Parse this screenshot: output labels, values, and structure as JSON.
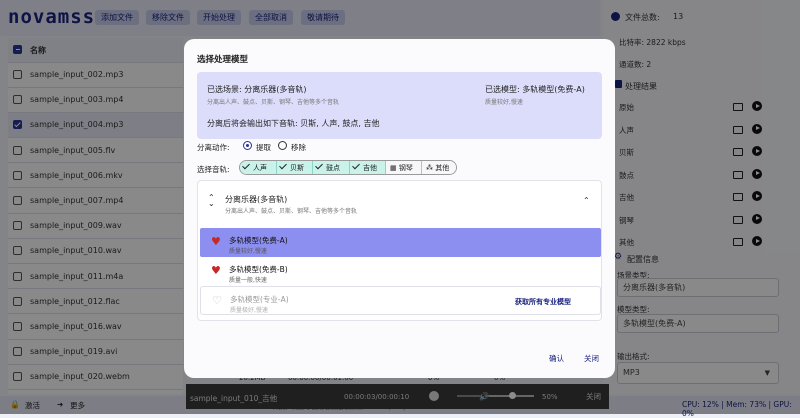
{
  "app": {
    "logo": "novamss",
    "toolbar": [
      "添加文件",
      "移除文件",
      "开始处理",
      "全部取消",
      "敬请期待"
    ]
  },
  "file_list": {
    "header": "名称",
    "items": [
      {
        "name": "sample_input_002.mp3",
        "checked": false
      },
      {
        "name": "sample_input_003.mp4",
        "checked": false
      },
      {
        "name": "sample_input_004.mp3",
        "checked": true
      },
      {
        "name": "sample_input_005.flv",
        "checked": false
      },
      {
        "name": "sample_input_006.mkv",
        "checked": false
      },
      {
        "name": "sample_input_007.mp4",
        "checked": false
      },
      {
        "name": "sample_input_009.wav",
        "checked": false
      },
      {
        "name": "sample_input_010.wav",
        "checked": false
      },
      {
        "name": "sample_input_011.m4a",
        "checked": false
      },
      {
        "name": "sample_input_012.flac",
        "checked": false
      },
      {
        "name": "sample_input_016.wav",
        "checked": false
      },
      {
        "name": "sample_input_019.avi",
        "checked": false
      },
      {
        "name": "sample_input_020.webm",
        "checked": false
      }
    ]
  },
  "right_panel": {
    "total_files_label": "文件总数:",
    "total_files": "13",
    "bitrate": "比特率:  2822 kbps",
    "channels": "通道数:  2",
    "results_title": "处理结果",
    "results": [
      "原始",
      "人声",
      "贝斯",
      "鼓点",
      "吉他",
      "钢琴",
      "其他"
    ],
    "config_title": "配置信息",
    "scene_label": "场景类型:",
    "scene_value": "分离乐器(多音轨)",
    "model_label": "模型类型:",
    "model_value": "多轨模型(免费-A)",
    "format_label": "输出格式:",
    "format_value": "MP3"
  },
  "bottom": {
    "activate": "激活",
    "more": "更多",
    "status": "CPU: 12% | Mem: 73% | GPU: 0%",
    "footer_text": "转换。请遵守使用者及版权条款 V1.0.0 | Surpss NovaMSS",
    "row_size": "20.2MB",
    "row_time": "00:00:00/00:01:00",
    "row_pct": "0%",
    "row_pct2": "0%"
  },
  "player": {
    "track": "sample_input_010_吉他",
    "time": "00:00:03/00:00:10",
    "volume": "50%",
    "close": "关闭"
  },
  "modal": {
    "title": "选择处理模型",
    "scene_line": "已选场景:  分离乐器(多音轨)",
    "scene_desc": "分离出人声、鼓点、贝斯、钢琴、吉他等多个音轨",
    "model_line": "已选模型:  多轨模型(免费-A)",
    "model_desc": "质量较好,慢速",
    "output_line": "分离后将会输出如下音轨:  贝斯, 人声, 鼓点, 吉他",
    "action_label": "分离动作:",
    "action_options": [
      "提取",
      "移除"
    ],
    "track_label": "选择音轨:",
    "tracks": [
      {
        "label": "人声",
        "selected": true
      },
      {
        "label": "贝斯",
        "selected": true
      },
      {
        "label": "鼓点",
        "selected": true
      },
      {
        "label": "吉他",
        "selected": true
      },
      {
        "label": "钢琴",
        "selected": false
      },
      {
        "label": "其他",
        "selected": false
      }
    ],
    "dropdown_title": "分离乐器(多音轨)",
    "dropdown_desc": "分离出人声、鼓点、贝斯、钢琴、吉他等多个音轨",
    "models": [
      {
        "name": "多轨模型(免费-A)",
        "desc": "质量较好,慢速"
      },
      {
        "name": "多轨模型(免费-B)",
        "desc": "质量一般,快速"
      },
      {
        "name": "多轨模型(专业-A)",
        "desc": "质量极好,慢速"
      }
    ],
    "pro_link": "获取所有专业模型",
    "confirm": "确认",
    "close": "关闭"
  },
  "colors": {
    "accent": "#1a237e",
    "selected_option": "#8c8ff0",
    "heart": "#c62828",
    "chip": "#c8f2ea"
  }
}
